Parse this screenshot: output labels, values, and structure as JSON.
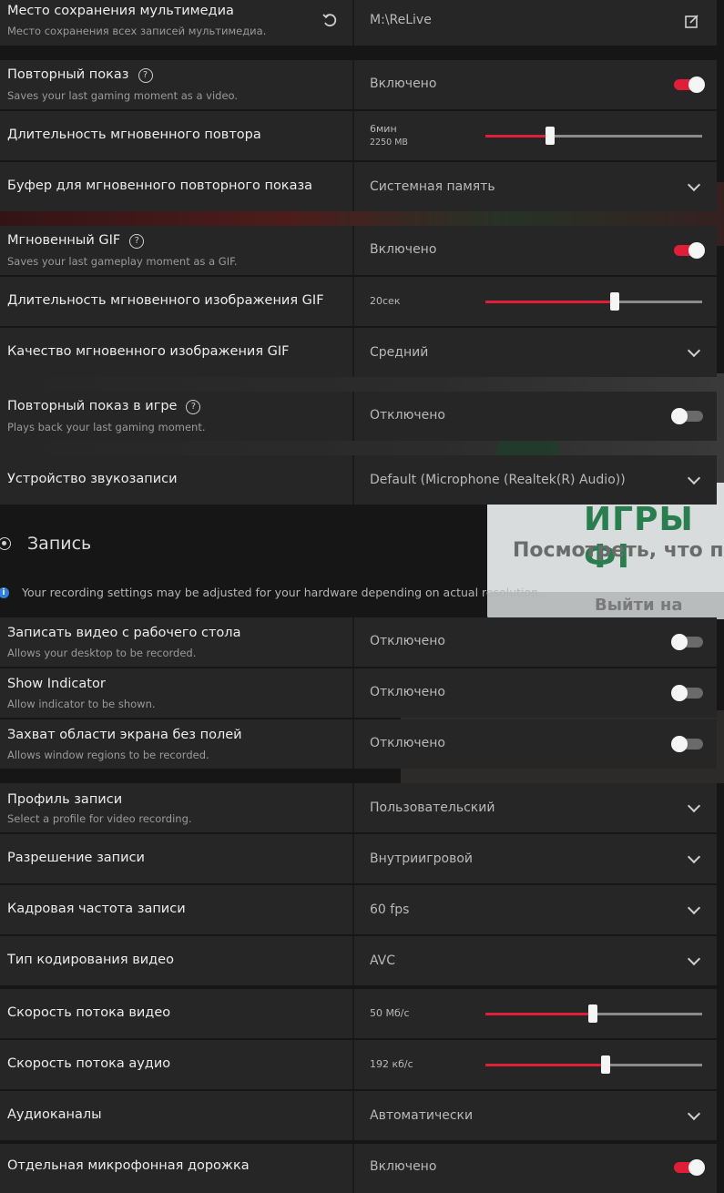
{
  "colors": {
    "accent": "#e01e37",
    "panel": "#262626",
    "info": "#2f7fe0"
  },
  "background": {
    "banner_title": "ИГРЫ ФІ",
    "banner_sub": "Посмотреть, что про",
    "banner_btn": "Выйти на"
  },
  "rows": {
    "media_location": {
      "title": "Место сохранения мультимедиа",
      "sub": "Место сохранения всех записей мультимедиа.",
      "value": "M:\\ReLive",
      "reset_icon": "undo-icon",
      "folder_icon": "folder-edit-icon"
    },
    "instant_replay": {
      "title": "Повторный показ",
      "sub": "Saves your last gaming moment as a video.",
      "value": "Включено",
      "toggle": "on"
    },
    "replay_duration": {
      "title": "Длительность мгновенного повтора",
      "value": "6мин",
      "size": "2250 MB",
      "slider_fraction": 0.3
    },
    "replay_buffer": {
      "title": "Буфер для мгновенного повторного показа",
      "value": "Системная память"
    },
    "instant_gif": {
      "title": "Мгновенный GIF",
      "sub": "Saves your last gameplay moment as a GIF.",
      "value": "Включено",
      "toggle": "on"
    },
    "gif_duration": {
      "title": "Длительность мгновенного изображения GIF",
      "value": "20сек",
      "slider_fraction": 0.595
    },
    "gif_quality": {
      "title": "Качество мгновенного изображения GIF",
      "value": "Средний"
    },
    "ingame_replay": {
      "title": "Повторный показ в игре",
      "sub": "Plays back your last gaming moment.",
      "value": "Отключено",
      "toggle": "off"
    },
    "audio_device": {
      "title": "Устройство звукозаписи",
      "value": "Default (Microphone (Realtek(R) Audio))"
    },
    "record_desktop": {
      "title": "Записать видео с рабочего стола",
      "sub": "Allows your desktop to be recorded.",
      "value": "Отключено",
      "toggle": "off"
    },
    "show_indicator": {
      "title": "Show Indicator",
      "sub": "Allow indicator to be shown.",
      "value": "Отключено",
      "toggle": "off"
    },
    "borderless_region": {
      "title": "Захват области экрана без полей",
      "sub": "Allows window regions to be recorded.",
      "value": "Отключено",
      "toggle": "off"
    },
    "record_profile": {
      "title": "Профиль записи",
      "sub": "Select a profile for video recording.",
      "value": "Пользовательский"
    },
    "record_resolution": {
      "title": "Разрешение записи",
      "value": "Внутриигровой"
    },
    "record_fps": {
      "title": "Кадровая частота записи",
      "value": "60 fps"
    },
    "video_encoding": {
      "title": "Тип кодирования видео",
      "value": "AVC"
    },
    "video_bitrate": {
      "title": "Скорость потока видео",
      "value": "50 Мб/с",
      "slider_fraction": 0.495
    },
    "audio_bitrate": {
      "title": "Скорость потока аудио",
      "value": "192 кб/с",
      "slider_fraction": 0.555
    },
    "audio_channels": {
      "title": "Аудиоканалы",
      "value": "Автоматически"
    },
    "separate_mic": {
      "title": "Отдельная микрофонная дорожка",
      "value": "Включено",
      "toggle": "on"
    }
  },
  "section": {
    "title": "Запись",
    "icon": "record-icon",
    "info": "Your recording settings may be adjusted for your hardware depending on actual resolution."
  }
}
